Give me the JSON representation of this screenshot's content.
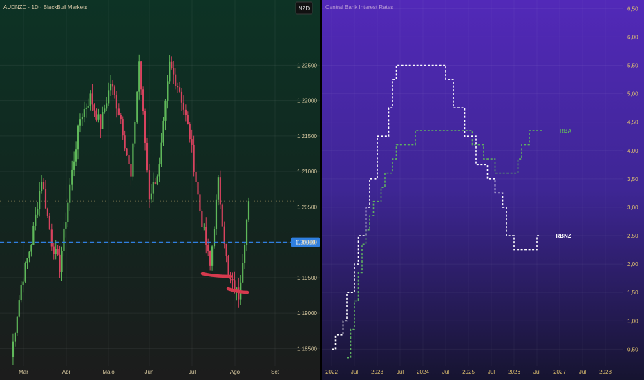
{
  "left_panel": {
    "title": "AUDNZD · 1D · BlackBull Markets",
    "currency_badge": "NZD",
    "price_highlight": "1,20000"
  },
  "right_panel": {
    "title": "Central Bank Interest Rates"
  },
  "colors": {
    "up": "#5fb85a",
    "down": "#d9435f",
    "annotation": "#d63a4e",
    "hline": "#2f7fe0",
    "rba": "#5fb060",
    "rbnz": "#ffffff"
  },
  "chart_data": [
    {
      "type": "candlestick",
      "title": "AUDNZD · 1D · BlackBull Markets",
      "x_ticks": [
        "Mar",
        "Abr",
        "Maio",
        "Jun",
        "Jul",
        "Ago",
        "Set"
      ],
      "y_ticks": [
        "1,18500",
        "1,19000",
        "1,19500",
        "1,20000",
        "1,20500",
        "1,21000",
        "1,21500",
        "1,22000",
        "1,22500"
      ],
      "ylim": [
        1.1825,
        1.2342
      ],
      "horizontal_line": 1.2,
      "dotted_line": 1.2058,
      "points": [
        {
          "date": "Mar",
          "price": 1.1838
        },
        {
          "date": "Mar",
          "price": 1.194
        },
        {
          "date": "Mar",
          "price": 1.2
        },
        {
          "date": "Mar",
          "price": 1.209
        },
        {
          "date": "Abr",
          "price": 1.2
        },
        {
          "date": "Abr",
          "price": 1.1965
        },
        {
          "date": "Abr",
          "price": 1.208
        },
        {
          "date": "Abr",
          "price": 1.2175
        },
        {
          "date": "Maio",
          "price": 1.2205
        },
        {
          "date": "Maio",
          "price": 1.2165
        },
        {
          "date": "Maio",
          "price": 1.2225
        },
        {
          "date": "Maio",
          "price": 1.2175
        },
        {
          "date": "Jun",
          "price": 1.209
        },
        {
          "date": "Jun",
          "price": 1.2255
        },
        {
          "date": "Jun",
          "price": 1.2065
        },
        {
          "date": "Jun",
          "price": 1.2105
        },
        {
          "date": "Jul",
          "price": 1.225
        },
        {
          "date": "Jul",
          "price": 1.2215
        },
        {
          "date": "Jul",
          "price": 1.215
        },
        {
          "date": "Jul",
          "price": 1.2045
        },
        {
          "date": "Ago",
          "price": 1.1965
        },
        {
          "date": "Ago",
          "price": 1.2085
        },
        {
          "date": "Ago",
          "price": 1.195
        },
        {
          "date": "Ago",
          "price": 1.1925
        },
        {
          "date": "Ago",
          "price": 1.2058
        }
      ]
    },
    {
      "type": "line",
      "title": "Central Bank Interest Rates",
      "x_ticks": [
        "2022",
        "Jul",
        "2023",
        "Jul",
        "2024",
        "Jul",
        "2025",
        "Jul",
        "2026",
        "Jul",
        "2027",
        "Jul",
        "2028"
      ],
      "y_ticks": [
        "0,50",
        "1,00",
        "1,50",
        "2,00",
        "2,50",
        "3,00",
        "3,50",
        "4,00",
        "4,50",
        "5,00",
        "5,50",
        "6,00",
        "6,50"
      ],
      "ylim": [
        0.2,
        6.65
      ],
      "series": [
        {
          "name": "RBA",
          "points": [
            {
              "x": "2022-05",
              "y": 0.35
            },
            {
              "x": "2022-06",
              "y": 0.85
            },
            {
              "x": "2022-07",
              "y": 1.35
            },
            {
              "x": "2022-08",
              "y": 1.85
            },
            {
              "x": "2022-09",
              "y": 2.35
            },
            {
              "x": "2022-10",
              "y": 2.6
            },
            {
              "x": "2022-11",
              "y": 2.85
            },
            {
              "x": "2022-12",
              "y": 3.1
            },
            {
              "x": "2023-02",
              "y": 3.35
            },
            {
              "x": "2023-03",
              "y": 3.6
            },
            {
              "x": "2023-05",
              "y": 3.85
            },
            {
              "x": "2023-06",
              "y": 4.1
            },
            {
              "x": "2023-11",
              "y": 4.35
            },
            {
              "x": "2025-02",
              "y": 4.1
            },
            {
              "x": "2025-05",
              "y": 3.85
            },
            {
              "x": "2025-08",
              "y": 3.6
            },
            {
              "x": "2026-02",
              "y": 3.85
            },
            {
              "x": "2026-03",
              "y": 4.1
            },
            {
              "x": "2026-05",
              "y": 4.35
            },
            {
              "x": "2026-09",
              "y": 4.35
            }
          ]
        },
        {
          "name": "RBNZ",
          "points": [
            {
              "x": "2022-01",
              "y": 0.5
            },
            {
              "x": "2022-02",
              "y": 0.75
            },
            {
              "x": "2022-04",
              "y": 1.0
            },
            {
              "x": "2022-05",
              "y": 1.5
            },
            {
              "x": "2022-07",
              "y": 2.0
            },
            {
              "x": "2022-08",
              "y": 2.5
            },
            {
              "x": "2022-10",
              "y": 3.0
            },
            {
              "x": "2022-11",
              "y": 3.5
            },
            {
              "x": "2023-01",
              "y": 4.25
            },
            {
              "x": "2023-04",
              "y": 4.75
            },
            {
              "x": "2023-05",
              "y": 5.25
            },
            {
              "x": "2023-06",
              "y": 5.5
            },
            {
              "x": "2024-07",
              "y": 5.25
            },
            {
              "x": "2024-09",
              "y": 4.75
            },
            {
              "x": "2024-12",
              "y": 4.25
            },
            {
              "x": "2025-03",
              "y": 3.75
            },
            {
              "x": "2025-06",
              "y": 3.5
            },
            {
              "x": "2025-08",
              "y": 3.25
            },
            {
              "x": "2025-10",
              "y": 3.0
            },
            {
              "x": "2025-11",
              "y": 2.5
            },
            {
              "x": "2026-01",
              "y": 2.25
            },
            {
              "x": "2026-07",
              "y": 2.5
            },
            {
              "x": "2026-08",
              "y": 2.5
            }
          ]
        }
      ]
    }
  ]
}
